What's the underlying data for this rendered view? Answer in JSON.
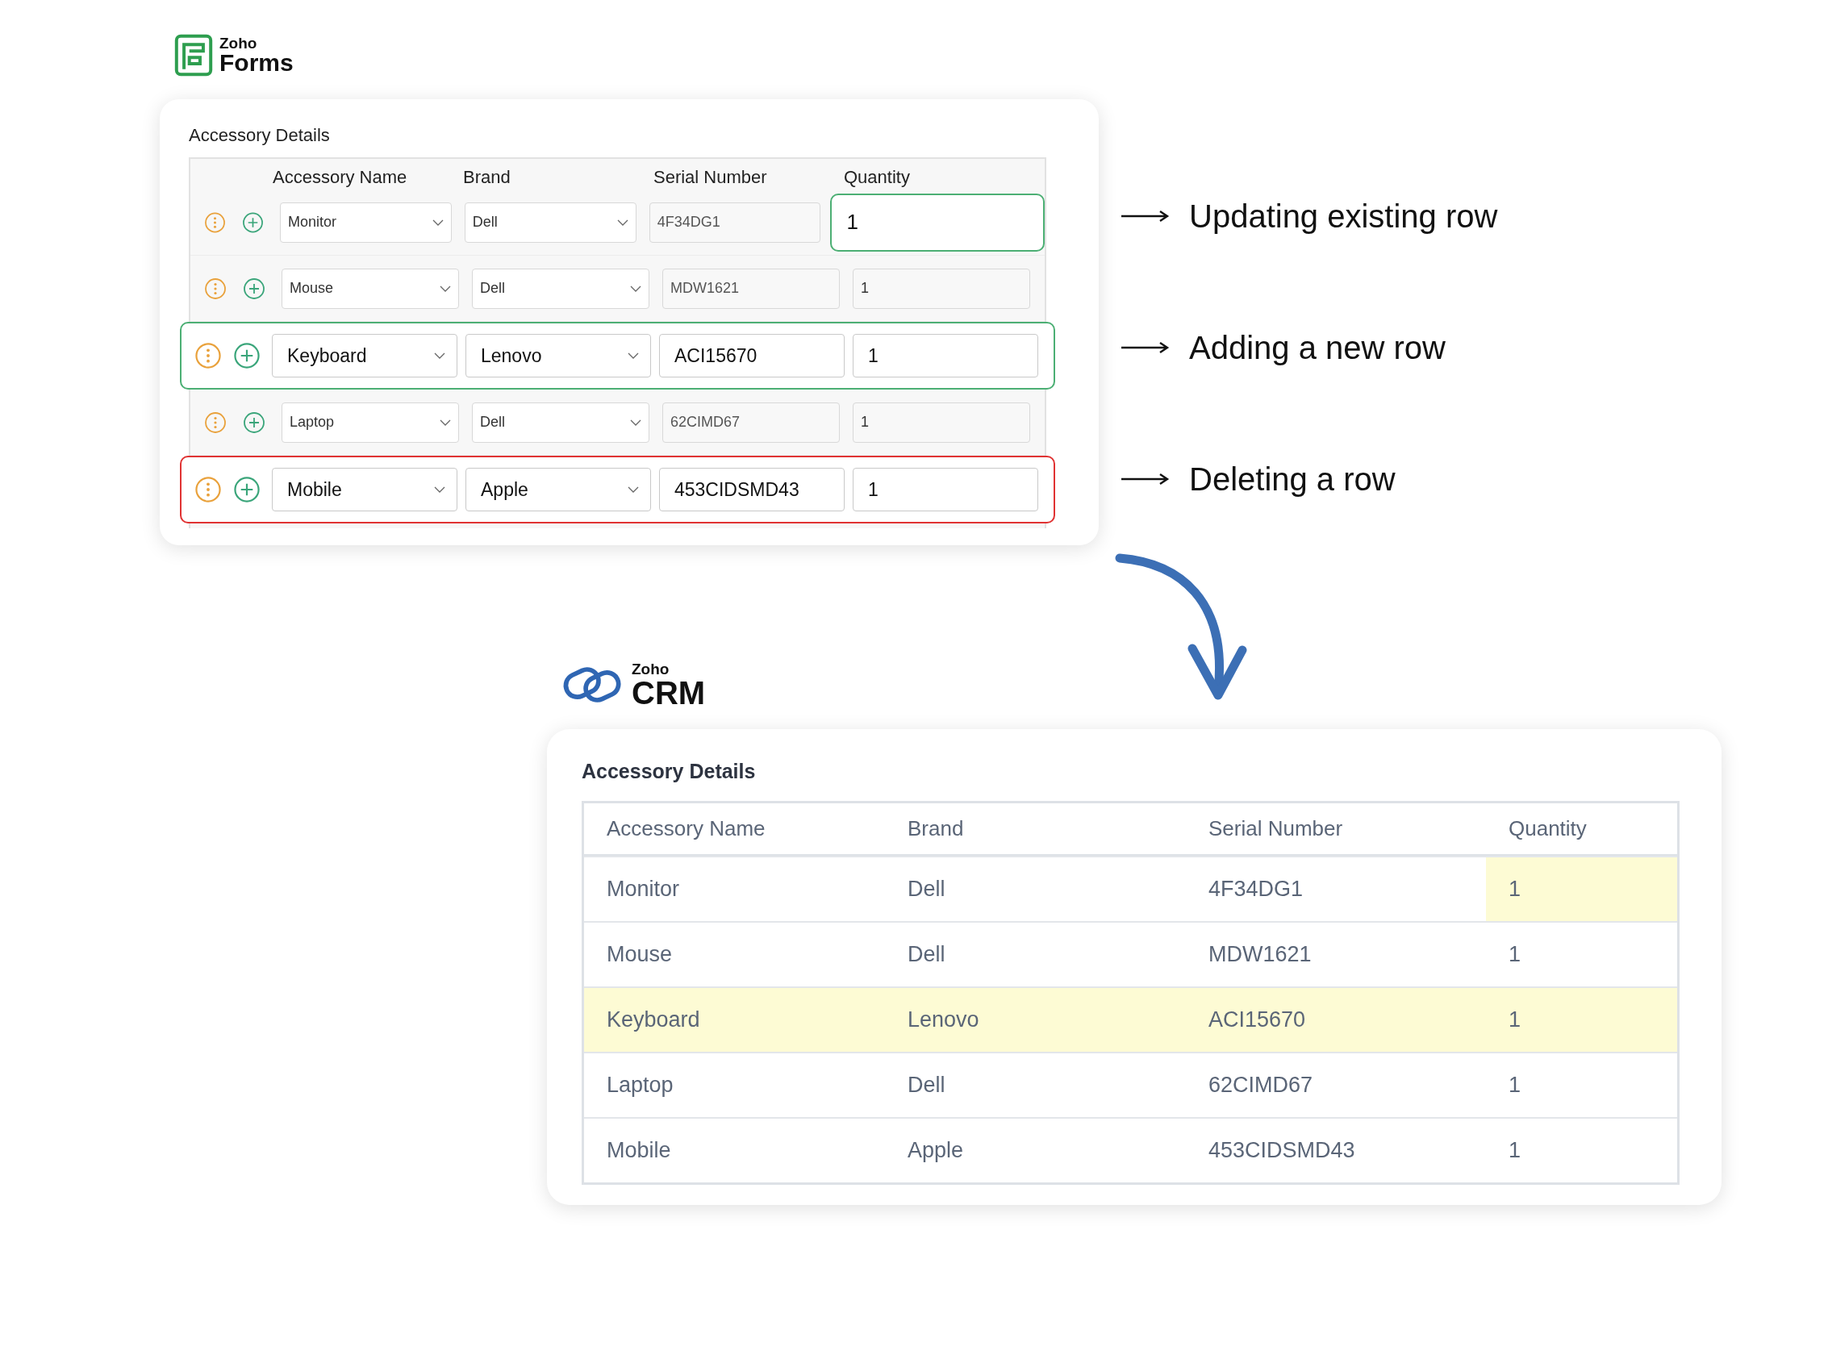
{
  "forms": {
    "logo": {
      "brand": "Zoho",
      "product": "Forms"
    },
    "section_title": "Accessory Details",
    "columns": [
      "Accessory Name",
      "Brand",
      "Serial Number",
      "Quantity"
    ],
    "rows": [
      {
        "quantity_changed": true,
        "added": false,
        "deleted": false,
        "name": "Monitor",
        "brand": "Dell",
        "serial": "4F34DG1",
        "quantity": "1"
      },
      {
        "quantity_changed": false,
        "added": false,
        "deleted": false,
        "name": "Mouse",
        "brand": "Dell",
        "serial": "MDW1621",
        "quantity": "1"
      },
      {
        "quantity_changed": false,
        "added": true,
        "deleted": false,
        "name": "Keyboard",
        "brand": "Lenovo",
        "serial": "ACI15670",
        "quantity": "1"
      },
      {
        "quantity_changed": false,
        "added": false,
        "deleted": false,
        "name": "Laptop",
        "brand": "Dell",
        "serial": "62CIMD67",
        "quantity": "1"
      },
      {
        "quantity_changed": false,
        "added": false,
        "deleted": true,
        "name": "Mobile",
        "brand": "Apple",
        "serial": "453CIDSMD43",
        "quantity": "1"
      }
    ]
  },
  "annotations": [
    {
      "text": "Updating existing row"
    },
    {
      "text": "Adding a new row"
    },
    {
      "text": "Deleting a row"
    }
  ],
  "crm": {
    "logo": {
      "brand": "Zoho",
      "product": "CRM"
    },
    "section_title": "Accessory Details",
    "columns": [
      "Accessory Name",
      "Brand",
      "Serial Number",
      "Quantity"
    ],
    "rows": [
      {
        "row_highlighted": false,
        "quantity_highlighted": true,
        "name": "Monitor",
        "brand": "Dell",
        "serial": "4F34DG1",
        "quantity": "1"
      },
      {
        "row_highlighted": false,
        "quantity_highlighted": false,
        "name": "Mouse",
        "brand": "Dell",
        "serial": "MDW1621",
        "quantity": "1"
      },
      {
        "row_highlighted": true,
        "quantity_highlighted": false,
        "name": "Keyboard",
        "brand": "Lenovo",
        "serial": "ACI15670",
        "quantity": "1"
      },
      {
        "row_highlighted": false,
        "quantity_highlighted": false,
        "name": "Laptop",
        "brand": "Dell",
        "serial": "62CIMD67",
        "quantity": "1"
      },
      {
        "row_highlighted": false,
        "quantity_highlighted": false,
        "name": "Mobile",
        "brand": "Apple",
        "serial": "453CIDSMD43",
        "quantity": "1"
      }
    ]
  }
}
